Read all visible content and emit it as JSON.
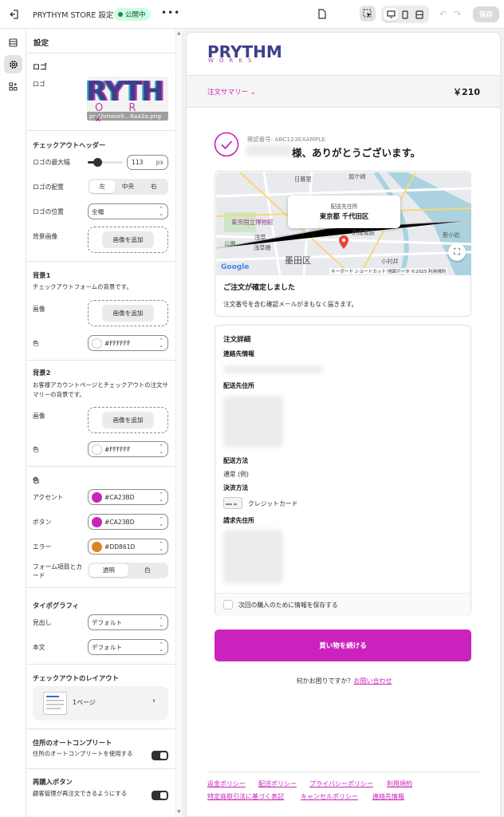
{
  "topbar": {
    "title": "PRYTHYM STORE 設定 2",
    "status": "公開中",
    "more": "•••",
    "save": "保存"
  },
  "colors": {
    "accent": "#CA23BD",
    "button": "#CA23BD",
    "error": "#DD861D",
    "white": "#FFFFFF"
  },
  "panel": {
    "title": "設定",
    "logo_section": "ロゴ",
    "logo_label": "ロゴ",
    "logo_thumb_text": "RYTH",
    "logo_thumb_sub": "O R K",
    "logo_filename": "prythmwork...6aa2a.png",
    "header_section": "チェックアウトヘッダー",
    "logo_max_width_label": "ロゴの最大幅",
    "logo_max_width_value": "113",
    "logo_max_width_unit": "px",
    "logo_align_label": "ロゴの配置",
    "align_left": "左",
    "align_center": "中央",
    "align_right": "右",
    "logo_position_label": "ロゴの位置",
    "logo_position_value": "全幅",
    "bg_image_label": "背景画像",
    "add_image": "画像を追加",
    "bg1_title": "背景1",
    "bg1_desc": "チェックアウトフォームの背景です。",
    "image_label": "画像",
    "color_label": "色",
    "bg1_color": "#FFFFFF",
    "bg2_title": "背景2",
    "bg2_desc": "お客様アカウントページとチェックアウトの注文サマリーの背景です。",
    "bg2_color": "#FFFFFF",
    "colors_title": "色",
    "accent_label": "アクセント",
    "accent_value": "#CA23BD",
    "button_label": "ボタン",
    "button_value": "#CA23BD",
    "error_label": "エラー",
    "error_value": "#DD861D",
    "form_label": "フォーム項目とカード",
    "form_transparent": "透明",
    "form_white": "白",
    "typo_title": "タイポグラフィ",
    "heading_label": "見出し",
    "heading_value": "デフォルト",
    "body_label": "本文",
    "body_value": "デフォルト",
    "layout_title": "チェックアウトのレイアウト",
    "layout_value": "1ページ",
    "autocomplete_title": "住所のオートコンプリート",
    "autocomplete_desc": "住所のオートコンプリートを使用する",
    "reorder_title": "再購入ボタン",
    "reorder_desc": "顧客管理が再注文できるようにする"
  },
  "preview": {
    "logo_main": "PRYTHM",
    "logo_sub": "WORKS",
    "summary_label": "注文サマリー",
    "summary_price": "￥210",
    "confirmation": "確認番号: ABC123EXAMPLE",
    "thanks": "様、ありがとうございます。",
    "map_caption": "配送先住所",
    "map_address": "東京都 千代田区",
    "map_label_1": "東京国立博物館",
    "map_label_2": "墨田区",
    "map_label_3": "京成電鉄",
    "map_label_4": "浅草",
    "map_label_5": "小村井",
    "map_label_6": "新小岩",
    "map_label_7": "公園",
    "map_label_8": "浅草橋",
    "map_label_9": "日暮里",
    "map_label_10": "堀ケ崎",
    "map_google": "Google",
    "map_credit": "キーボード ショートカット  地図データ ©2025  利用規約",
    "confirmed_title": "ご注文が確定しました",
    "confirmed_desc": "注文番号を含む確認メールがまもなく届きます。",
    "details_title": "注文詳細",
    "contact_label": "連絡先情報",
    "shipping_addr_label": "配送先住所",
    "shipping_method_label": "配送方法",
    "shipping_method_value": "通常 (例)",
    "payment_label": "決済方法",
    "payment_value": "クレジットカード",
    "billing_label": "請求先住所",
    "save_info": "次回の購入のために情報を保存する",
    "continue": "買い物を続ける",
    "help_text": "何かお困りですか？",
    "help_link": "お問い合わせ",
    "footer_links": [
      "返金ポリシー",
      "配送ポリシー",
      "プライバシーポリシー",
      "利用規約",
      "特定商取引法に基づく表記",
      "キャンセルポリシー",
      "連絡先情報"
    ]
  }
}
